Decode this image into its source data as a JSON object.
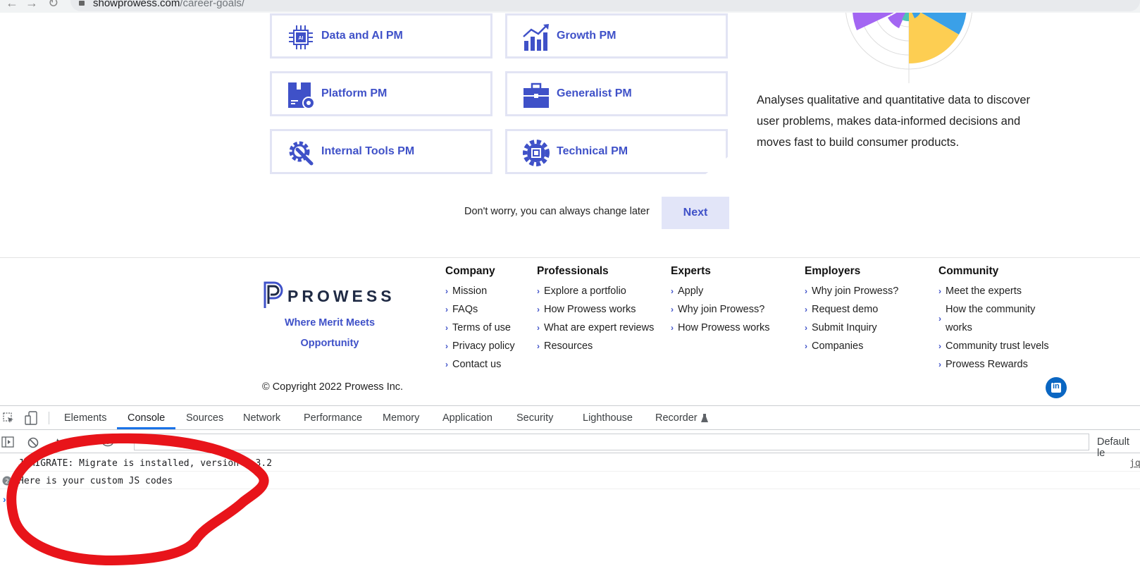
{
  "browser": {
    "url_host": "showprowess.com",
    "url_path": "/career-goals/"
  },
  "roles": [
    {
      "label": "Data and AI PM",
      "icon": "chip-icon"
    },
    {
      "label": "Growth PM",
      "icon": "growth-chart-icon"
    },
    {
      "label": "Platform PM",
      "icon": "platform-gear-icon"
    },
    {
      "label": "Generalist PM",
      "icon": "briefcase-icon"
    },
    {
      "label": "Internal Tools PM",
      "icon": "wrench-gear-icon"
    },
    {
      "label": "Technical PM",
      "icon": "cpu-gear-icon"
    }
  ],
  "description": "Analyses qualitative and quantitative data to discover user problems, makes data-informed decisions and moves fast to build consumer products.",
  "hint": "Don't worry, you can always change later",
  "next_label": "Next",
  "footer": {
    "logo_text": "PROWESS",
    "tagline": "Where Merit Meets Opportunity",
    "copyright": "© Copyright 2022 Prowess Inc.",
    "columns": [
      {
        "heading": "Company",
        "items": [
          "Mission",
          "FAQs",
          "Terms of use",
          "Privacy policy",
          "Contact us"
        ]
      },
      {
        "heading": "Professionals",
        "items": [
          "Explore a portfolio",
          "How Prowess works",
          "What are expert reviews",
          "Resources"
        ]
      },
      {
        "heading": "Experts",
        "items": [
          "Apply",
          "Why join Prowess?",
          "How Prowess works"
        ]
      },
      {
        "heading": "Employers",
        "items": [
          "Why join Prowess?",
          "Request demo",
          "Submit Inquiry",
          "Companies"
        ]
      },
      {
        "heading": "Community",
        "items": [
          "Meet the experts",
          "How the community works",
          "Community trust levels",
          "Prowess Rewards"
        ]
      }
    ]
  },
  "devtools": {
    "tabs": [
      "Elements",
      "Console",
      "Sources",
      "Network",
      "Performance",
      "Memory",
      "Application",
      "Security",
      "Lighthouse",
      "Recorder"
    ],
    "active_tab": "Console",
    "context": "top",
    "level": "Default le",
    "logs": [
      {
        "text": "JQMIGRATE: Migrate is installed, version 3.3.2",
        "source": "jq"
      },
      {
        "text": "Here is your custom JS codes",
        "source": ""
      }
    ]
  },
  "colors": {
    "accent": "#3f51c8",
    "annotation": "#e8141a"
  }
}
